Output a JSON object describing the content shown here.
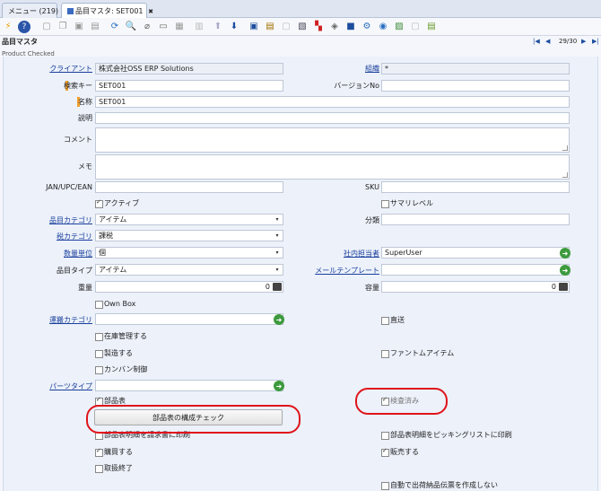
{
  "tabs": {
    "menu": "メニュー (219)",
    "product": "品目マスタ: SET001",
    "close_glyph": "✖"
  },
  "window": {
    "title": "品目マスタ",
    "subtitle": "Product Checked",
    "record_nav": "29/30"
  },
  "fields": {
    "client_label": "クライアント",
    "client_value": "株式会社OSS ERP Solutions",
    "org_label": "組織",
    "org_value": "*",
    "search_key_label": "検索キー",
    "search_key_value": "SET001",
    "version_label": "バージョンNo",
    "version_value": "",
    "name_label": "名称",
    "name_value": "SET001",
    "description_label": "説明",
    "comment_label": "コメント",
    "memo_label": "メモ",
    "upc_label": "JAN/UPC/EAN",
    "sku_label": "SKU",
    "active_label": "アクティブ",
    "summary_label": "サマリレベル",
    "product_category_label": "品目カテゴリ",
    "product_category_value": "アイテム",
    "classification_label": "分類",
    "tax_category_label": "税カテゴリ",
    "tax_category_value": "課税",
    "uom_label": "数量単位",
    "uom_value": "個",
    "sales_rep_label": "社内担当者",
    "sales_rep_value": "SuperUser",
    "product_type_label": "品目タイプ",
    "product_type_value": "アイテム",
    "mail_template_label": "メールテンプレート",
    "weight_label": "重量",
    "weight_value": "0",
    "volume_label": "容量",
    "volume_value": "0",
    "own_box_label": "Own Box",
    "freight_category_label": "運搬カテゴリ",
    "drop_ship_label": "直送",
    "stocked_label": "在庫管理する",
    "manufactured_label": "製造する",
    "phantom_label": "ファントムアイテム",
    "kanban_label": "カンバン制御",
    "part_type_label": "パーツタイプ",
    "bom_label": "部品表",
    "verified_label": "検査済み",
    "bom_check_button": "部品表の構成チェック",
    "print_detail_label": "部品表明細を請求書に印刷",
    "print_picklist_label": "部品表明細をピッキングリストに印刷",
    "purchased_label": "購買する",
    "sold_label": "販売する",
    "discontinued_label": "取扱終了",
    "auto_ship_label": "自動で出荷納品伝票を作成しない"
  },
  "icons": {
    "dropdown": "▾",
    "zoom": "➜",
    "first": "|◀",
    "prev": "◀",
    "next": "▶",
    "last": "▶|"
  },
  "colors": {
    "annotation": "#e0141b",
    "link": "#1a3f9c",
    "mandatory": "#f0a030"
  }
}
